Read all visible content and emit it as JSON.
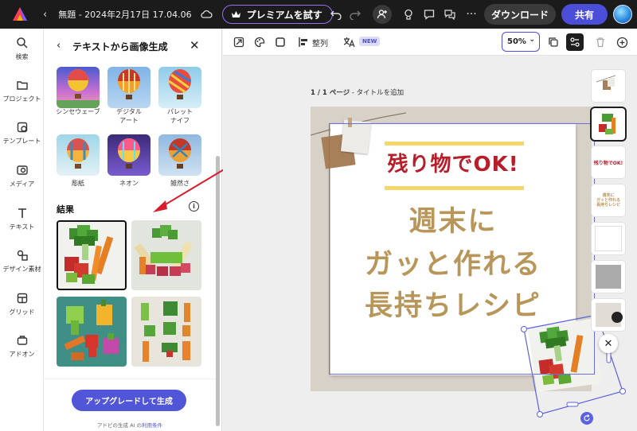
{
  "topbar": {
    "doc_title": "無題 - 2024年2月17日 17.04.06",
    "premium_label": "プレミアムを試す",
    "download_label": "ダウンロード",
    "share_label": "共有"
  },
  "rail": {
    "items": [
      {
        "label": "検索",
        "icon": "search-icon"
      },
      {
        "label": "プロジェクト",
        "icon": "folder-icon"
      },
      {
        "label": "テンプレート",
        "icon": "template-icon"
      },
      {
        "label": "メディア",
        "icon": "media-icon"
      },
      {
        "label": "テキスト",
        "icon": "text-icon"
      },
      {
        "label": "デザイン素材",
        "icon": "shapes-icon"
      },
      {
        "label": "グリッド",
        "icon": "grid-icon"
      },
      {
        "label": "アドオン",
        "icon": "addon-icon"
      }
    ]
  },
  "panel": {
    "title": "テキストから画像生成",
    "styles": [
      {
        "label": "シンセウェーブ"
      },
      {
        "label": "デジタル\nアート"
      },
      {
        "label": "パレット\nナイフ"
      },
      {
        "label": "彫紙"
      },
      {
        "label": "ネオン"
      },
      {
        "label": "雑然さ"
      }
    ],
    "results_title": "結果",
    "upgrade_label": "アップグレードして生成",
    "terms_prefix": "アドビの生成 AI の",
    "terms_link": "利用条件"
  },
  "toolbar": {
    "arrange_label": "整列",
    "new_badge": "NEW",
    "zoom_value": "50%"
  },
  "canvas": {
    "page_label_bold": "1 / 1 ページ",
    "page_label_rest": " - タイトルを追加",
    "headline": "残り物でOK!",
    "line1": "週末に",
    "line2": "ガッと作れる",
    "line3": "長持ちレシピ"
  },
  "colors": {
    "accent": "#4b4ed8",
    "headline_red": "#b81e2a",
    "title_gold": "#b89558",
    "bar_yellow": "#f7d76a"
  }
}
